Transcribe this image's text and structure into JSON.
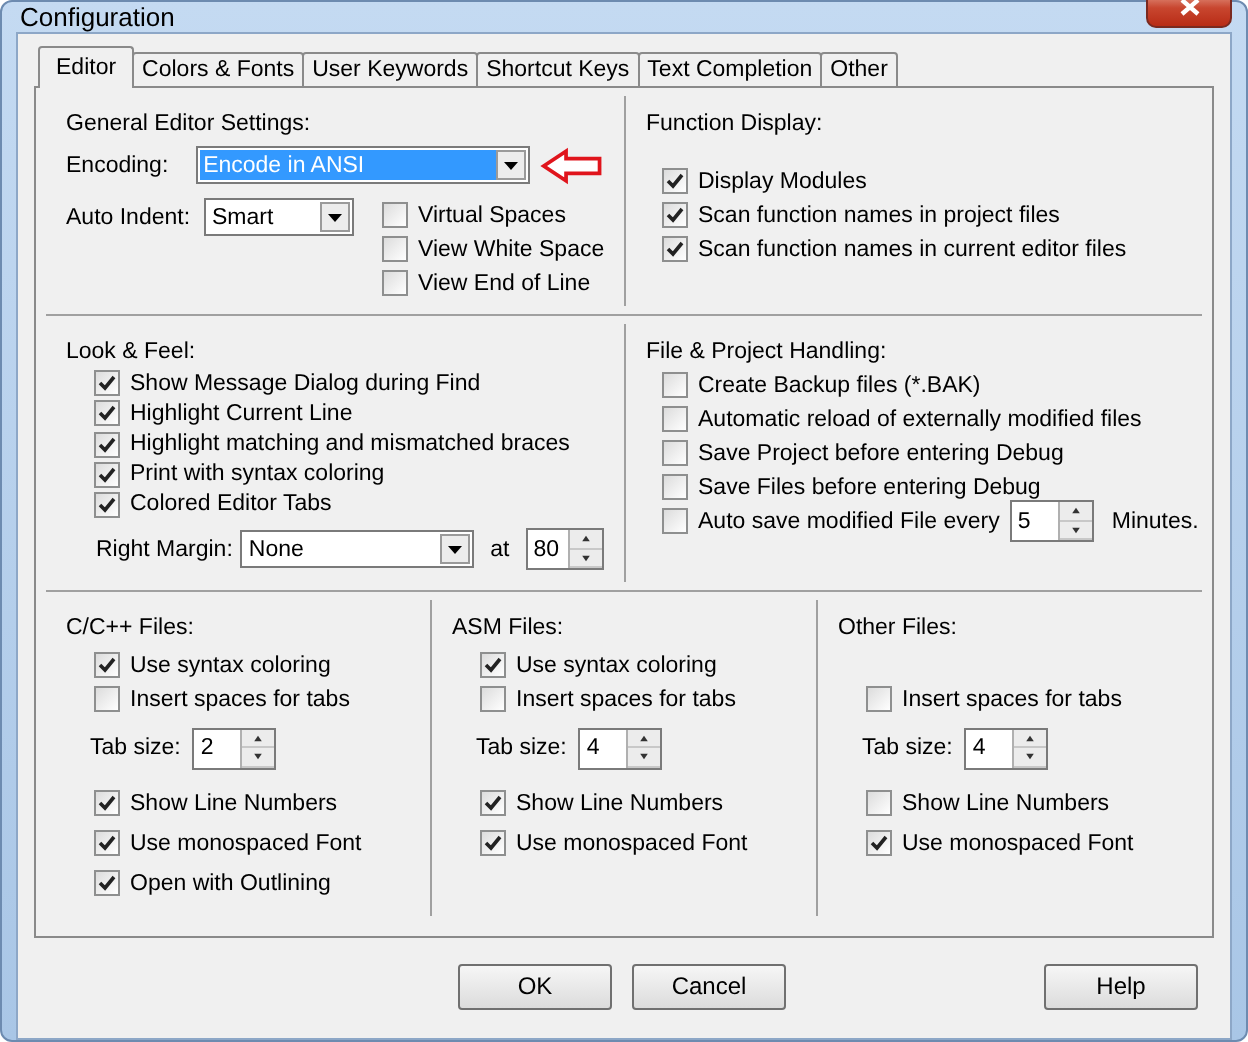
{
  "window": {
    "title": "Configuration"
  },
  "tabs": [
    {
      "label": "Editor",
      "selected": true
    },
    {
      "label": "Colors & Fonts",
      "selected": false
    },
    {
      "label": "User Keywords",
      "selected": false
    },
    {
      "label": "Shortcut Keys",
      "selected": false
    },
    {
      "label": "Text Completion",
      "selected": false
    },
    {
      "label": "Other",
      "selected": false
    }
  ],
  "general_editor_settings": {
    "title": "General Editor Settings:",
    "encoding": {
      "label": "Encoding:",
      "value": "Encode in ANSI"
    },
    "auto_indent": {
      "label": "Auto Indent:",
      "value": "Smart"
    },
    "options": [
      {
        "label": "Virtual Spaces",
        "checked": false
      },
      {
        "label": "View White Space",
        "checked": false
      },
      {
        "label": "View End of Line",
        "checked": false
      }
    ]
  },
  "function_display": {
    "title": "Function Display:",
    "options": [
      {
        "label": "Display Modules",
        "checked": true
      },
      {
        "label": "Scan function names in project files",
        "checked": true
      },
      {
        "label": "Scan function names in current editor files",
        "checked": true
      }
    ]
  },
  "look_and_feel": {
    "title": "Look & Feel:",
    "options": [
      {
        "label": "Show Message Dialog during Find",
        "checked": true
      },
      {
        "label": "Highlight Current Line",
        "checked": true
      },
      {
        "label": "Highlight matching and mismatched braces",
        "checked": true
      },
      {
        "label": "Print with syntax coloring",
        "checked": true
      },
      {
        "label": "Colored Editor Tabs",
        "checked": true
      }
    ],
    "right_margin": {
      "label": "Right Margin:",
      "value": "None",
      "at_label": "at",
      "at_value": "80"
    }
  },
  "file_project_handling": {
    "title": "File & Project Handling:",
    "options": [
      {
        "label": "Create Backup files (*.BAK)",
        "checked": false
      },
      {
        "label": "Automatic reload of externally modified files",
        "checked": false
      },
      {
        "label": "Save Project before entering Debug",
        "checked": false
      },
      {
        "label": "Save Files before entering Debug",
        "checked": false
      }
    ],
    "auto_save": {
      "label": "Auto save modified File every",
      "checked": false,
      "value": "5",
      "suffix": "Minutes."
    }
  },
  "file_types": [
    {
      "title": "C/C++ Files:",
      "items": [
        {
          "kind": "syntax",
          "label": "Use syntax coloring",
          "checked": true
        },
        {
          "kind": "spaces",
          "label": "Insert spaces for tabs",
          "checked": false
        },
        {
          "kind": "tabsize",
          "label": "Tab size:",
          "value": "2"
        },
        {
          "kind": "linenumbers",
          "label": "Show Line Numbers",
          "checked": true
        },
        {
          "kind": "mono",
          "label": "Use monospaced Font",
          "checked": true
        },
        {
          "kind": "outlining",
          "label": "Open with Outlining",
          "checked": true
        }
      ]
    },
    {
      "title": "ASM Files:",
      "items": [
        {
          "kind": "syntax",
          "label": "Use syntax coloring",
          "checked": true
        },
        {
          "kind": "spaces",
          "label": "Insert spaces for tabs",
          "checked": false
        },
        {
          "kind": "tabsize",
          "label": "Tab size:",
          "value": "4"
        },
        {
          "kind": "linenumbers",
          "label": "Show Line Numbers",
          "checked": true
        },
        {
          "kind": "mono",
          "label": "Use monospaced Font",
          "checked": true
        }
      ]
    },
    {
      "title": "Other Files:",
      "items": [
        {
          "kind": "spaces",
          "label": "Insert spaces for tabs",
          "checked": false
        },
        {
          "kind": "tabsize",
          "label": "Tab size:",
          "value": "4"
        },
        {
          "kind": "linenumbers",
          "label": "Show Line Numbers",
          "checked": false
        },
        {
          "kind": "mono",
          "label": "Use monospaced Font",
          "checked": true
        }
      ]
    }
  ],
  "buttons": [
    {
      "label": "OK",
      "kind": "ok"
    },
    {
      "label": "Cancel",
      "kind": "cancel"
    },
    {
      "label": "Help",
      "kind": "help"
    }
  ]
}
